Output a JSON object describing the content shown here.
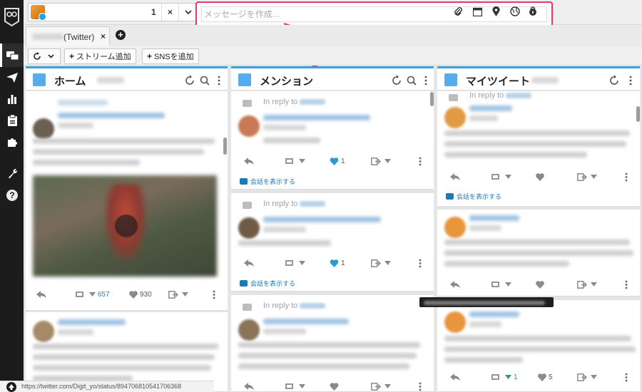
{
  "topbar": {
    "account_count": "1",
    "close_label": "×",
    "composer_placeholder": "メッセージを作成..."
  },
  "tabs": [
    {
      "label": "(Twitter)",
      "close": "×"
    }
  ],
  "tab_add": "+",
  "toolbar": {
    "add_stream": "ストリーム追加",
    "add_sns": "SNSを追加",
    "plus": "+"
  },
  "columns": [
    {
      "title": "ホーム"
    },
    {
      "title": "メンション"
    },
    {
      "title": "マイツイート"
    }
  ],
  "home": {
    "tweet1": {
      "retweets": "657",
      "likes": "930"
    }
  },
  "mentions": {
    "reply_label": "In reply to",
    "show_conversation": "会話を表示する",
    "likes": [
      "1",
      "1"
    ]
  },
  "mytweets": {
    "reply_label": "In reply to",
    "show_conversation": "会話を表示する",
    "last": {
      "retweets": "1",
      "likes": "5"
    }
  },
  "sidebar": {
    "help": "?"
  },
  "status": {
    "url": "https://twitter.com/Digit_yo/status/894706810541706368"
  },
  "colors": {
    "accent_pink": "#e8386b",
    "twitter_blue": "#55acee",
    "like_blue": "#2b9bd8",
    "sidebar_bg": "#1c1c1c"
  }
}
